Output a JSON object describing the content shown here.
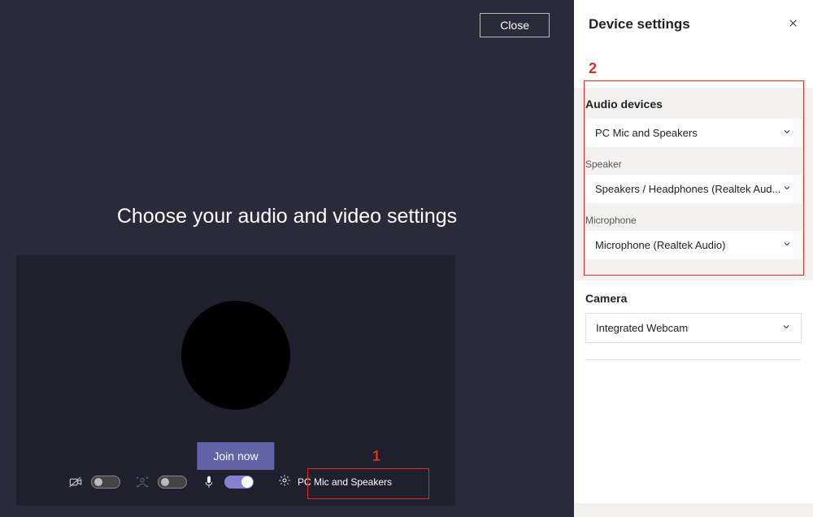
{
  "main": {
    "close_label": "Close",
    "title": "Choose your audio and video settings",
    "join_label": "Join now",
    "device_summary": "PC Mic and Speakers"
  },
  "annotations": {
    "one": "1",
    "two": "2"
  },
  "sidebar": {
    "title": "Device settings",
    "audio_section_title": "Audio devices",
    "audio_device_value": "PC Mic and Speakers",
    "speaker_label": "Speaker",
    "speaker_value": "Speakers / Headphones (Realtek Aud...",
    "microphone_label": "Microphone",
    "microphone_value": "Microphone (Realtek Audio)",
    "camera_section_title": "Camera",
    "camera_value": "Integrated Webcam"
  }
}
